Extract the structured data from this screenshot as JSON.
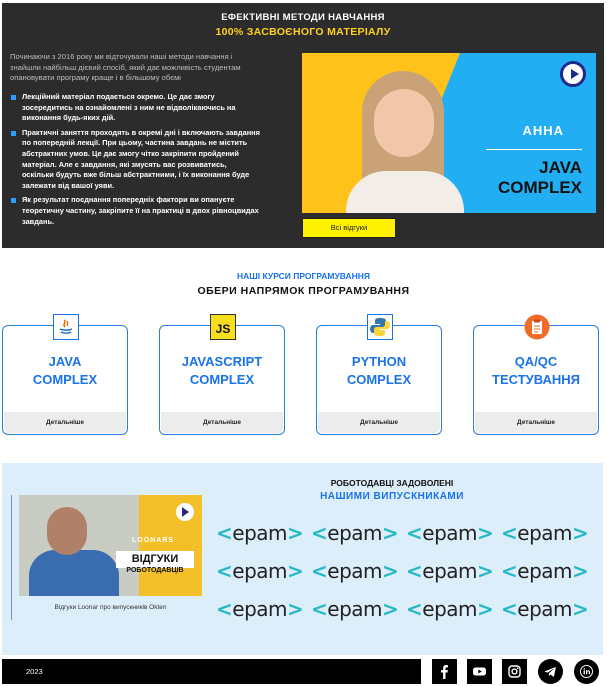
{
  "methods": {
    "title": "ЕФЕКТИВНІ МЕТОДИ НАВЧАННЯ",
    "subtitle": "100% ЗАСВОЄНОГО МАТЕРІАЛУ",
    "intro": "Починаючи з 2016 року ми відточували наші методи навчання і знайшли найбільш дієвий спосіб, який дає можливість студентам опановувати програму краще і в більшому обємі",
    "bullets": [
      "Лекційний матеріал подається окремо. Це дає змогу зосередитись на ознайомлені з ним не відволікаючись на виконання будь-яких дій.",
      "Практичні заняття проходять в окремі дні і включають завдання по попередній лекції. При цьому, частина завдань не містить абстрактних умов. Це дає змогу чітко закріпити пройдений матеріал. Але є завдання, які змусять вас розвиватись, оскільки будуть вже більш абстрактними, і їх виконання буде залежати від вашої уяви.",
      "Як результат поєднання попередніх фактори ви опануєте теоретичну частину, закріпите її на практиці в двох рівноцвидах завдань."
    ],
    "promo": {
      "student_name": "АННА",
      "course_line1": "JAVA",
      "course_line2": "COMPLEX"
    },
    "reviews_button": "Всі відгуки"
  },
  "courses": {
    "kicker": "НАШІ КУРСИ ПРОГРАМУВАННЯ",
    "title": "ОБЕРИ НАПРЯМОК ПРОГРАМУВАННЯ",
    "items": [
      {
        "line1": "JAVA",
        "line2": "COMPLEX",
        "details": "Детальніше",
        "icon": "java-icon"
      },
      {
        "line1": "JAVASCRIPT",
        "line2": "COMPLEX",
        "details": "Детальніше",
        "icon": "javascript-icon",
        "icon_text": "JS"
      },
      {
        "line1": "PYTHON",
        "line2": "COMPLEX",
        "details": "Детальніше",
        "icon": "python-icon"
      },
      {
        "line1": "QA/QC",
        "line2": "ТЕСТУВАННЯ",
        "details": "Детальніше",
        "icon": "clipboard-icon"
      }
    ]
  },
  "employers": {
    "title": "РОБОТОДАВЦІ ЗАДОВОЛЕНІ",
    "subtitle": "НАШИМИ ВИПУСКНИКАМИ",
    "video": {
      "brand": "LOONARS",
      "caption_line1": "ВІДГУКИ",
      "caption_line2": "РОБОТОДАВЦІВ"
    },
    "video_caption": "Відгуки Loonar про випускників Okten",
    "logo_text": "epam",
    "logo_left": "<",
    "logo_right": ">"
  },
  "footer": {
    "year": "2023",
    "social": [
      "facebook-icon",
      "youtube-icon",
      "instagram-icon",
      "telegram-icon",
      "linkedin-icon"
    ]
  },
  "colors": {
    "accent_blue": "#1a73e8",
    "yellow": "#ffd21e",
    "dark_bg": "#2c2c2c",
    "light_blue_bg": "#ddeefb",
    "epam_teal": "#27b8c5"
  }
}
